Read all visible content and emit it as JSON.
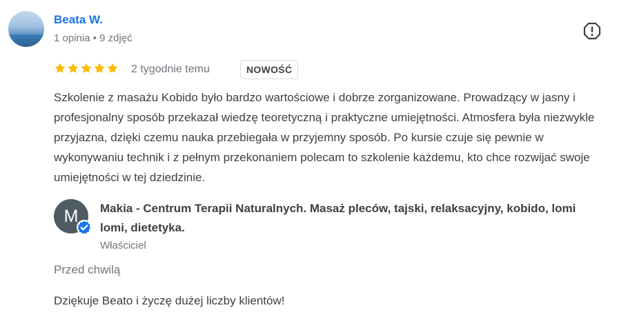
{
  "review": {
    "author": {
      "name": "Beata W.",
      "meta": "1 opinia • 9 zdjęć",
      "avatar_icon": "sea-horizon-photo"
    },
    "report_icon": "report-flag-icon",
    "rating": {
      "value": 5,
      "max": 5,
      "star_color": "#fbbc04"
    },
    "time": "2 tygodnie temu",
    "badge": "NOWOŚĆ",
    "text": "Szkolenie z masażu Kobido było bardzo wartościowe i dobrze zorganizowane. Prowadzący w jasny i profesjonalny sposób przekazał wiedzę teoretyczną i praktyczne umiejętności. Atmosfera była niezwykle przyjazna, dzięki czemu nauka przebiegała w przyjemny sposób. Po kursie czuje się pewnie w wykonywaniu technik i z pełnym przekonaniem polecam to szkolenie każdemu, kto chce rozwijać swoje umiejętności w tej dziedzinie."
  },
  "owner_reply": {
    "avatar_letter": "M",
    "verified_icon": "verified-badge-icon",
    "name": "Makia - Centrum Terapii Naturalnych. Masaż pleców, tajski, relaksacyjny, kobido, lomi lomi, dietetyka.",
    "role": "Właściciel",
    "time": "Przed chwilą",
    "text": "Dziękuje Beato i życzę dużej liczby klientów!"
  },
  "colors": {
    "link": "#1a73e8",
    "star": "#fbbc04",
    "verified": "#1a73e8",
    "owner_avatar_bg": "#4e5b63"
  }
}
